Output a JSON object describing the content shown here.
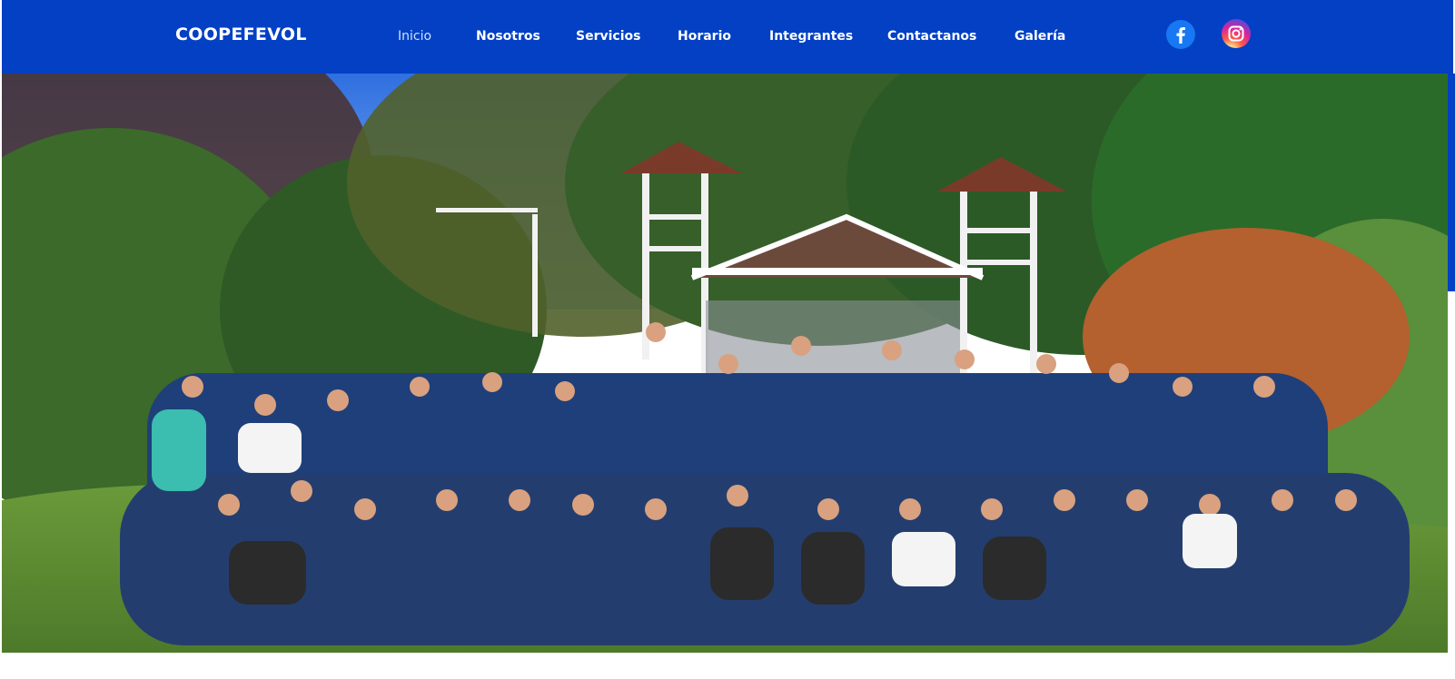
{
  "brand": "COOPEFEVOL",
  "nav": [
    {
      "label": "Inicio",
      "active": true
    },
    {
      "label": "Nosotros"
    },
    {
      "label": "Servicios"
    },
    {
      "label": "Horario"
    },
    {
      "label": "Integrantes"
    },
    {
      "label": "Contactanos"
    },
    {
      "label": "Galería"
    }
  ],
  "social": [
    {
      "name": "facebook-icon",
      "color": "#1877f2"
    },
    {
      "name": "instagram-icon",
      "color": "#d6249f"
    }
  ],
  "colors": {
    "navbar": "#0340c4",
    "nav_text": "#ffffff",
    "nav_active_text": "#cfe0ff"
  }
}
